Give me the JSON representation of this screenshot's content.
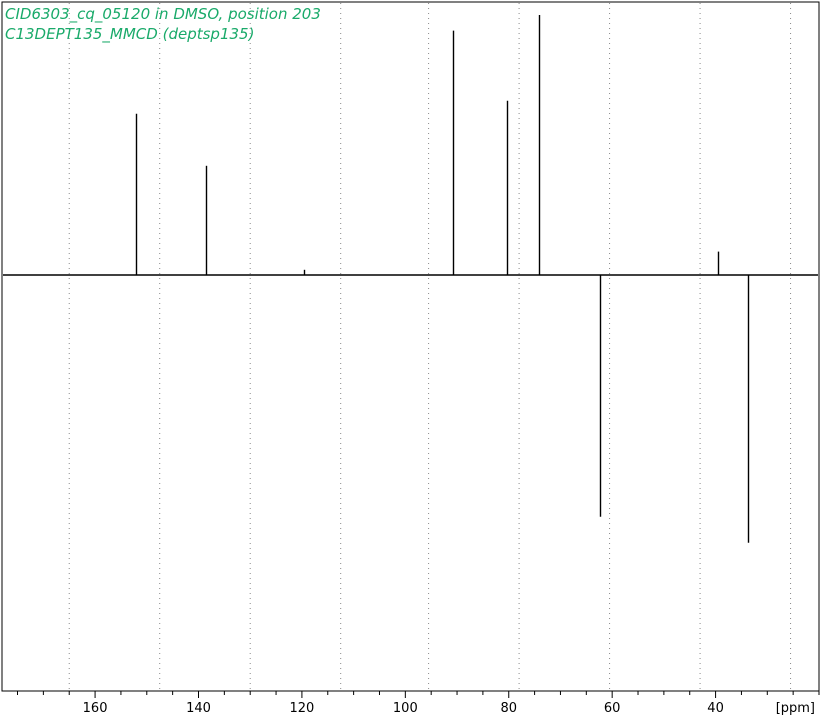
{
  "chart_data": {
    "type": "line",
    "title_lines": [
      "CID6303_cq_05120 in DMSO, position 203",
      "C13DEPT135_MMCD (deptsp135)"
    ],
    "title_color": "#1aaa6a",
    "xlabel": "[ppm]",
    "ylabel": "",
    "x_reversed": true,
    "xlim": [
      178,
      20
    ],
    "x_major_ticks": [
      160,
      140,
      120,
      100,
      80,
      60,
      40
    ],
    "x_minor_step": 5,
    "grid_x": [
      165,
      147.5,
      130,
      112.5,
      95.5,
      78,
      60.5,
      43,
      25.5
    ],
    "grid": "vertical dotted",
    "ylim": [
      -1.6,
      1.05
    ],
    "line_color": "#000000",
    "peaks": [
      {
        "ppm": 152.0,
        "intensity": 0.62
      },
      {
        "ppm": 138.6,
        "intensity": 0.42
      },
      {
        "ppm": 119.5,
        "intensity": 0.02
      },
      {
        "ppm": 90.8,
        "intensity": 0.94
      },
      {
        "ppm": 80.4,
        "intensity": 0.67
      },
      {
        "ppm": 74.2,
        "intensity": 1.0
      },
      {
        "ppm": 62.4,
        "intensity": -0.93
      },
      {
        "ppm": 39.5,
        "intensity": 0.09
      },
      {
        "ppm": 33.8,
        "intensity": -1.03
      }
    ]
  }
}
